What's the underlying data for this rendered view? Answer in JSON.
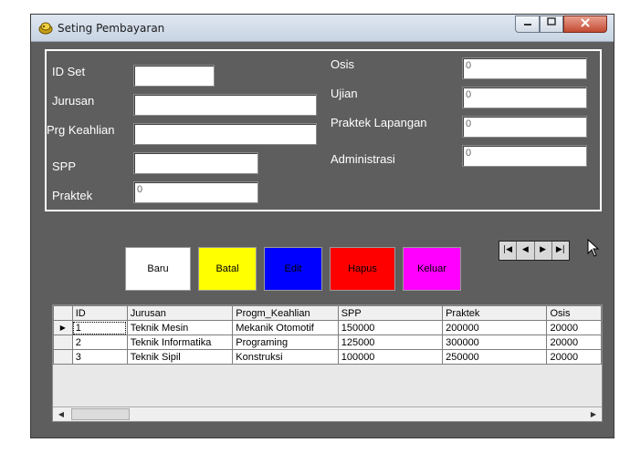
{
  "window": {
    "title": "Seting Pembayaran",
    "min": "0",
    "max": "1",
    "close": "r"
  },
  "form": {
    "labels": {
      "id_set": "ID Set",
      "jurusan": "Jurusan",
      "prg_keahlian": "Prg Keahlian",
      "spp": "SPP",
      "praktek": "Praktek",
      "osis": "Osis",
      "ujian": "Ujian",
      "praktek_lapangan": "Praktek Lapangan",
      "administrasi": "Administrasi"
    },
    "values": {
      "id_set": "",
      "jurusan": "",
      "prg_keahlian": "",
      "spp": "",
      "praktek": "0",
      "osis": "0",
      "ujian": "0",
      "praktek_lapangan": "0",
      "administrasi": "0"
    }
  },
  "buttons": {
    "baru": {
      "label": "Baru",
      "bg": "#ffffff",
      "fg": "#000000"
    },
    "batal": {
      "label": "Batal",
      "bg": "#ffff00",
      "fg": "#000000"
    },
    "edit": {
      "label": "Edit",
      "bg": "#0000ff",
      "fg": "#000000"
    },
    "hapus": {
      "label": "Hapus",
      "bg": "#ff0000",
      "fg": "#000000"
    },
    "keluar": {
      "label": "Keluar",
      "bg": "#ff00ff",
      "fg": "#000000"
    }
  },
  "navigator": {
    "first": "|◀",
    "prev": "◀",
    "next": "▶",
    "last": "▶|"
  },
  "grid": {
    "columns": [
      "ID",
      "Jurusan",
      "Progm_Keahlian",
      "SPP",
      "Praktek",
      "Osis"
    ],
    "rows": [
      [
        "1",
        "Teknik Mesin",
        "Mekanik Otomotif",
        "150000",
        "200000",
        "20000"
      ],
      [
        "2",
        "Teknik Informatika",
        "Programing",
        "125000",
        "300000",
        "20000"
      ],
      [
        "3",
        "Teknik Sipil",
        "Konstruksi",
        "100000",
        "250000",
        "20000"
      ]
    ],
    "current_row_marker": "▶",
    "scroll_left": "◀",
    "scroll_right": "▶"
  }
}
